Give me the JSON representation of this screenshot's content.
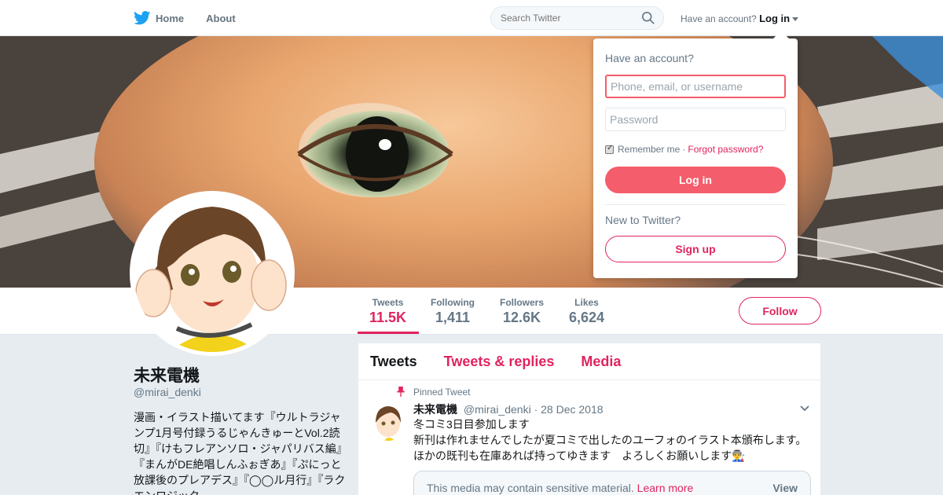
{
  "nav": {
    "home_label": "Home",
    "about_label": "About",
    "search_placeholder": "Search Twitter",
    "have_account": "Have an account?",
    "login_label": "Log in"
  },
  "profile": {
    "name": "未来電機",
    "handle": "@mirai_denki",
    "bio": "漫画・イラスト描いてます『ウルトラジャンプ1月号付録うるじゃんきゅーとVol.2読切』『けもフレアンソロ・ジャパリバス編』『まんがDE絶唱しんふぉぎあ』『ぷにっと放課後のプレアデス』『◯◯ル月行』『ラクエンロジック"
  },
  "stats": [
    {
      "label": "Tweets",
      "value": "11.5K"
    },
    {
      "label": "Following",
      "value": "1,411"
    },
    {
      "label": "Followers",
      "value": "12.6K"
    },
    {
      "label": "Likes",
      "value": "6,624"
    }
  ],
  "follow_label": "Follow",
  "timeline": {
    "tabs": [
      "Tweets",
      "Tweets & replies",
      "Media"
    ],
    "pinned_label": "Pinned Tweet",
    "tweet": {
      "name": "未来電機",
      "handle": "@mirai_denki",
      "date": "· 28 Dec 2018",
      "lines": [
        "冬コミ3日目参加します",
        "新刊は作れませんでしたが夏コミで出したのユーフォのイラスト本頒布します。",
        "ほかの既刊も在庫あれば持ってゆきます　よろしくお願いします👨‍🏭"
      ],
      "sensitive_text": "This media may contain sensitive material.",
      "learn_more": "Learn more",
      "view_label": "View"
    }
  },
  "login_dropdown": {
    "title": "Have an account?",
    "username_placeholder": "Phone, email, or username",
    "password_placeholder": "Password",
    "remember_label": "Remember me",
    "separator": "·",
    "forgot_label": "Forgot password?",
    "login_button": "Log in",
    "new_label": "New to Twitter?",
    "signup_button": "Sign up"
  },
  "colors": {
    "accent": "#e0245e",
    "login_button": "#f45d6b",
    "twitter_blue": "#1da1f2"
  },
  "icons": [
    "twitter-bird-icon",
    "search-icon",
    "caret-down-icon",
    "pin-icon",
    "chevron-down-icon"
  ]
}
